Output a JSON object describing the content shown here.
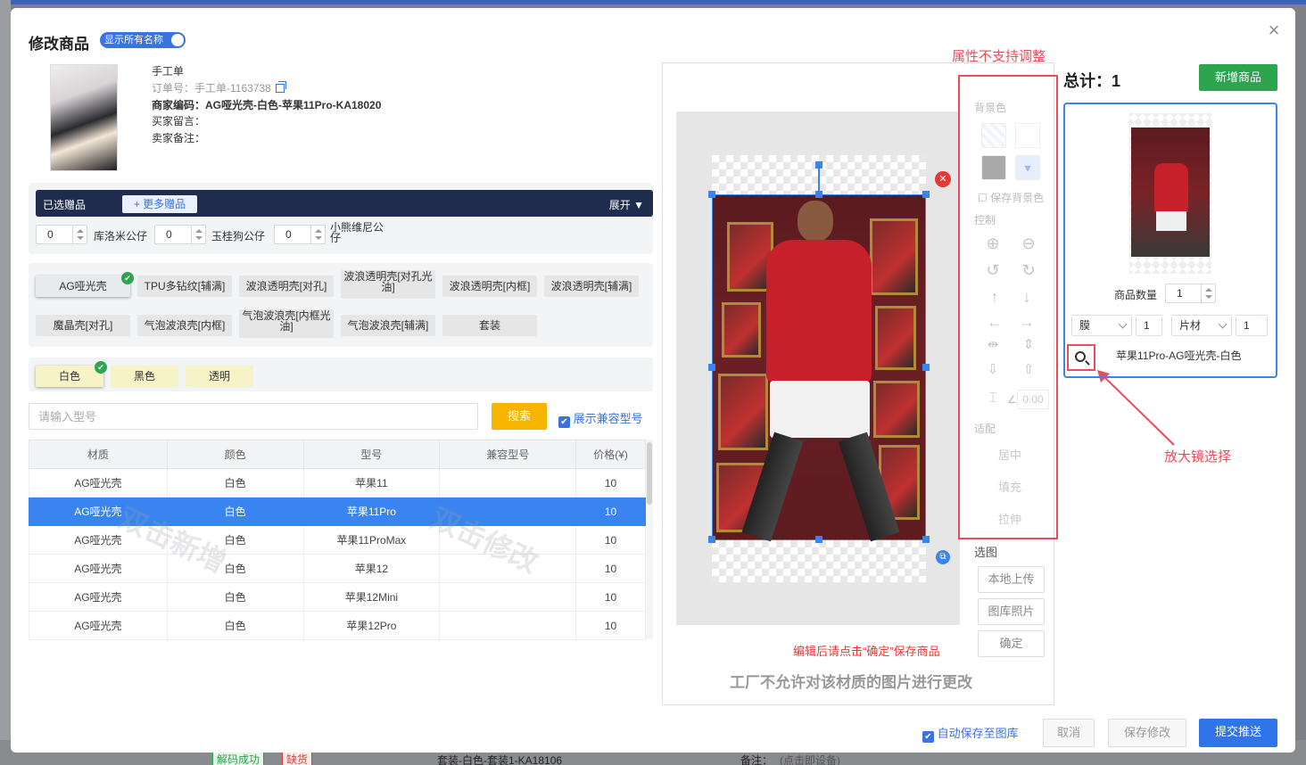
{
  "modal": {
    "title": "修改商品",
    "show_names_toggle": "显示所有名称",
    "close": "×"
  },
  "order": {
    "type": "手工单",
    "order_no": "订单号：手工单-1163738",
    "merchant_code": "商家编码：AG哑光壳-白色-苹果11Pro-KA18020",
    "buyer_msg": "买家留言：",
    "seller_note": "卖家备注："
  },
  "gifts": {
    "selected_label": "已选赠品",
    "more_label": "+ 更多赠品",
    "expand_label": "展开",
    "items": [
      {
        "qty": "0",
        "name": "库洛米公仔"
      },
      {
        "qty": "0",
        "name": "玉桂狗公仔"
      },
      {
        "qty": "0",
        "name": "小熊维尼公仔"
      }
    ]
  },
  "materials": [
    {
      "label": "AG哑光壳",
      "selected": true
    },
    {
      "label": "TPU多钻纹[辅满]"
    },
    {
      "label": "波浪透明壳[对孔]"
    },
    {
      "label": "波浪透明壳[对孔光油]"
    },
    {
      "label": "波浪透明壳[内框]"
    },
    {
      "label": "波浪透明壳[辅满]"
    },
    {
      "label": "魔晶壳[对孔]"
    },
    {
      "label": "气泡波浪壳[内框]"
    },
    {
      "label": "气泡波浪壳[内框光油]"
    },
    {
      "label": "气泡波浪壳[辅满]"
    },
    {
      "label": "套装"
    }
  ],
  "colors": [
    {
      "label": "白色",
      "selected": true
    },
    {
      "label": "黑色"
    },
    {
      "label": "透明"
    }
  ],
  "search": {
    "placeholder": "请输入型号",
    "button": "搜索",
    "show_compat": "展示兼容型号"
  },
  "table": {
    "headers": [
      "材质",
      "颜色",
      "型号",
      "兼容型号",
      "价格(¥)"
    ],
    "rows": [
      [
        "AG哑光壳",
        "白色",
        "苹果11",
        "",
        "10"
      ],
      [
        "AG哑光壳",
        "白色",
        "苹果11Pro",
        "",
        "10"
      ],
      [
        "AG哑光壳",
        "白色",
        "苹果11ProMax",
        "",
        "10"
      ],
      [
        "AG哑光壳",
        "白色",
        "苹果12",
        "",
        "10"
      ],
      [
        "AG哑光壳",
        "白色",
        "苹果12Mini",
        "",
        "10"
      ],
      [
        "AG哑光壳",
        "白色",
        "苹果12Pro",
        "",
        "10"
      ]
    ],
    "selected_row": 1,
    "watermark_add": "双击新增",
    "watermark_edit": "双击修改"
  },
  "tools": {
    "bg_label": "背景色",
    "save_bg": "保存背景色",
    "control_label": "控制",
    "angle_value": "0.00",
    "fit_label": "适配",
    "center": "居中",
    "fill": "填充",
    "stretch": "拉伸",
    "pick_label": "选图",
    "local_upload": "本地上传",
    "gallery": "图库照片",
    "confirm": "确定"
  },
  "editor": {
    "red_note": "编辑后请点击“确定”保存商品",
    "bottom_note": "工厂不允许对该材质的图片进行更改"
  },
  "annotations": {
    "attr_note": "属性不支持调整",
    "magnifier_note": "放大镜选择"
  },
  "right": {
    "total_label": "总计：",
    "total_value": "1",
    "add_button": "新增商品",
    "qty_label": "商品数量",
    "qty_value": "1",
    "film_option": "膜",
    "film_qty": "1",
    "sheet_option": "片材",
    "sheet_qty": "1",
    "product_name": "苹果11Pro-AG哑光壳-白色"
  },
  "footer": {
    "auto_save": "自动保存至图库",
    "cancel": "取消",
    "save": "保存修改",
    "submit": "提交推送"
  },
  "background": {
    "badge1": "解码成功",
    "badge2": "缺货",
    "row_text": "套装-白色-套装1-KA18106",
    "note_label": "备注：",
    "note_value": "(点击即设备)"
  },
  "colors_theme": {
    "primary": "#3a84f0",
    "green": "#2da44e",
    "orange": "#f7b500",
    "red": "#ef4a5a"
  }
}
